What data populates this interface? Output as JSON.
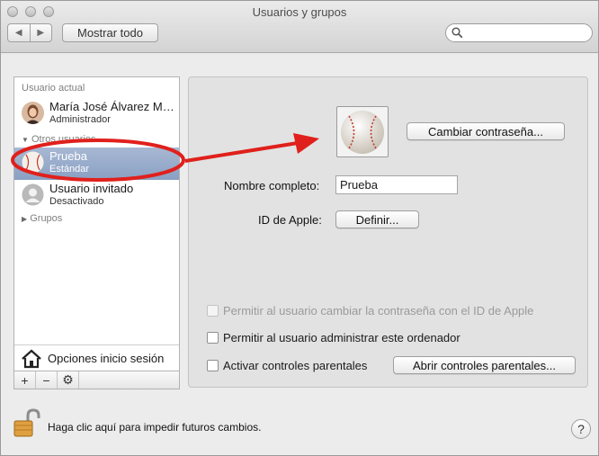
{
  "window": {
    "title": "Usuarios y grupos"
  },
  "toolbar": {
    "back_glyph": "◀",
    "forward_glyph": "▶",
    "show_all_label": "Mostrar todo",
    "search_placeholder": ""
  },
  "sidebar": {
    "current_user_header": "Usuario actual",
    "current_user": {
      "name": "María José Álvarez M…",
      "role": "Administrador"
    },
    "other_users_header": "Otros usuarios",
    "other_users": [
      {
        "name": "Prueba",
        "role": "Estándar"
      },
      {
        "name": "Usuario invitado",
        "role": "Desactivado"
      }
    ],
    "groups_label": "Grupos",
    "login_options_label": "Opciones inicio sesión",
    "tools": {
      "add": "+",
      "remove": "−",
      "settings": "⚙"
    }
  },
  "panel": {
    "change_password_label": "Cambiar contraseña...",
    "full_name_label": "Nombre completo:",
    "full_name_value": "Prueba",
    "apple_id_label": "ID de Apple:",
    "define_button_label": "Definir...",
    "checkboxes": [
      {
        "label": "Permitir al usuario cambiar la contraseña con el ID de Apple",
        "checked": false,
        "enabled": false
      },
      {
        "label": "Permitir al usuario administrar este ordenador",
        "checked": false,
        "enabled": true
      },
      {
        "label": "Activar controles parentales",
        "checked": false,
        "enabled": true
      }
    ],
    "open_parental_label": "Abrir controles parentales..."
  },
  "footer": {
    "lock_text": "Haga clic aquí para impedir futuros cambios.",
    "help_glyph": "?"
  },
  "annotation": {
    "color": "#e0201c"
  }
}
